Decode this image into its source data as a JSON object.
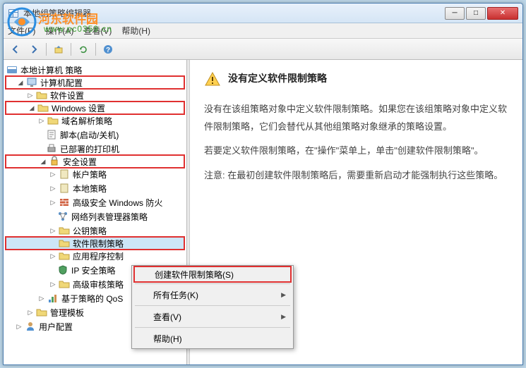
{
  "window": {
    "title": "本地组策略编辑器"
  },
  "menubar": {
    "file": "文件(F)",
    "action": "操作(A)",
    "view": "查看(V)",
    "help": "帮助(H)"
  },
  "tree": {
    "root": "本地计算机 策略",
    "computer_config": "计算机配置",
    "software_settings": "软件设置",
    "windows_settings": "Windows 设置",
    "dns_policy": "域名解析策略",
    "scripts": "脚本(启动/关机)",
    "deployed_printers": "已部署的打印机",
    "security_settings": "安全设置",
    "account_policy": "帐户策略",
    "local_policy": "本地策略",
    "advanced_firewall": "高级安全 Windows 防火",
    "network_list": "网络列表管理器策略",
    "public_key": "公钥策略",
    "software_restriction": "软件限制策略",
    "app_control": "应用程序控制",
    "ip_security": "IP 安全策略",
    "advanced_audit": "高级审核策略",
    "qos": "基于策略的 QoS",
    "admin_templates": "管理模板",
    "user_config": "用户配置"
  },
  "right": {
    "warning_title": "没有定义软件限制策略",
    "p1": "没有在该组策略对象中定义软件限制策略。如果您在该组策略对象中定义软件限制策略，它们会替代从其他组策略对象继承的策略设置。",
    "p2": "若要定义软件限制策略，在\"操作\"菜单上，单击\"创建软件限制策略\"。",
    "p3": "注意: 在最初创建软件限制策略后，需要重新启动才能强制执行这些策略。"
  },
  "context_menu": {
    "create": "创建软件限制策略(S)",
    "all_tasks": "所有任务(K)",
    "view": "查看(V)",
    "help": "帮助(H)"
  },
  "watermark": {
    "brand": "河东软件园",
    "url": "www.pc0359.cn"
  }
}
